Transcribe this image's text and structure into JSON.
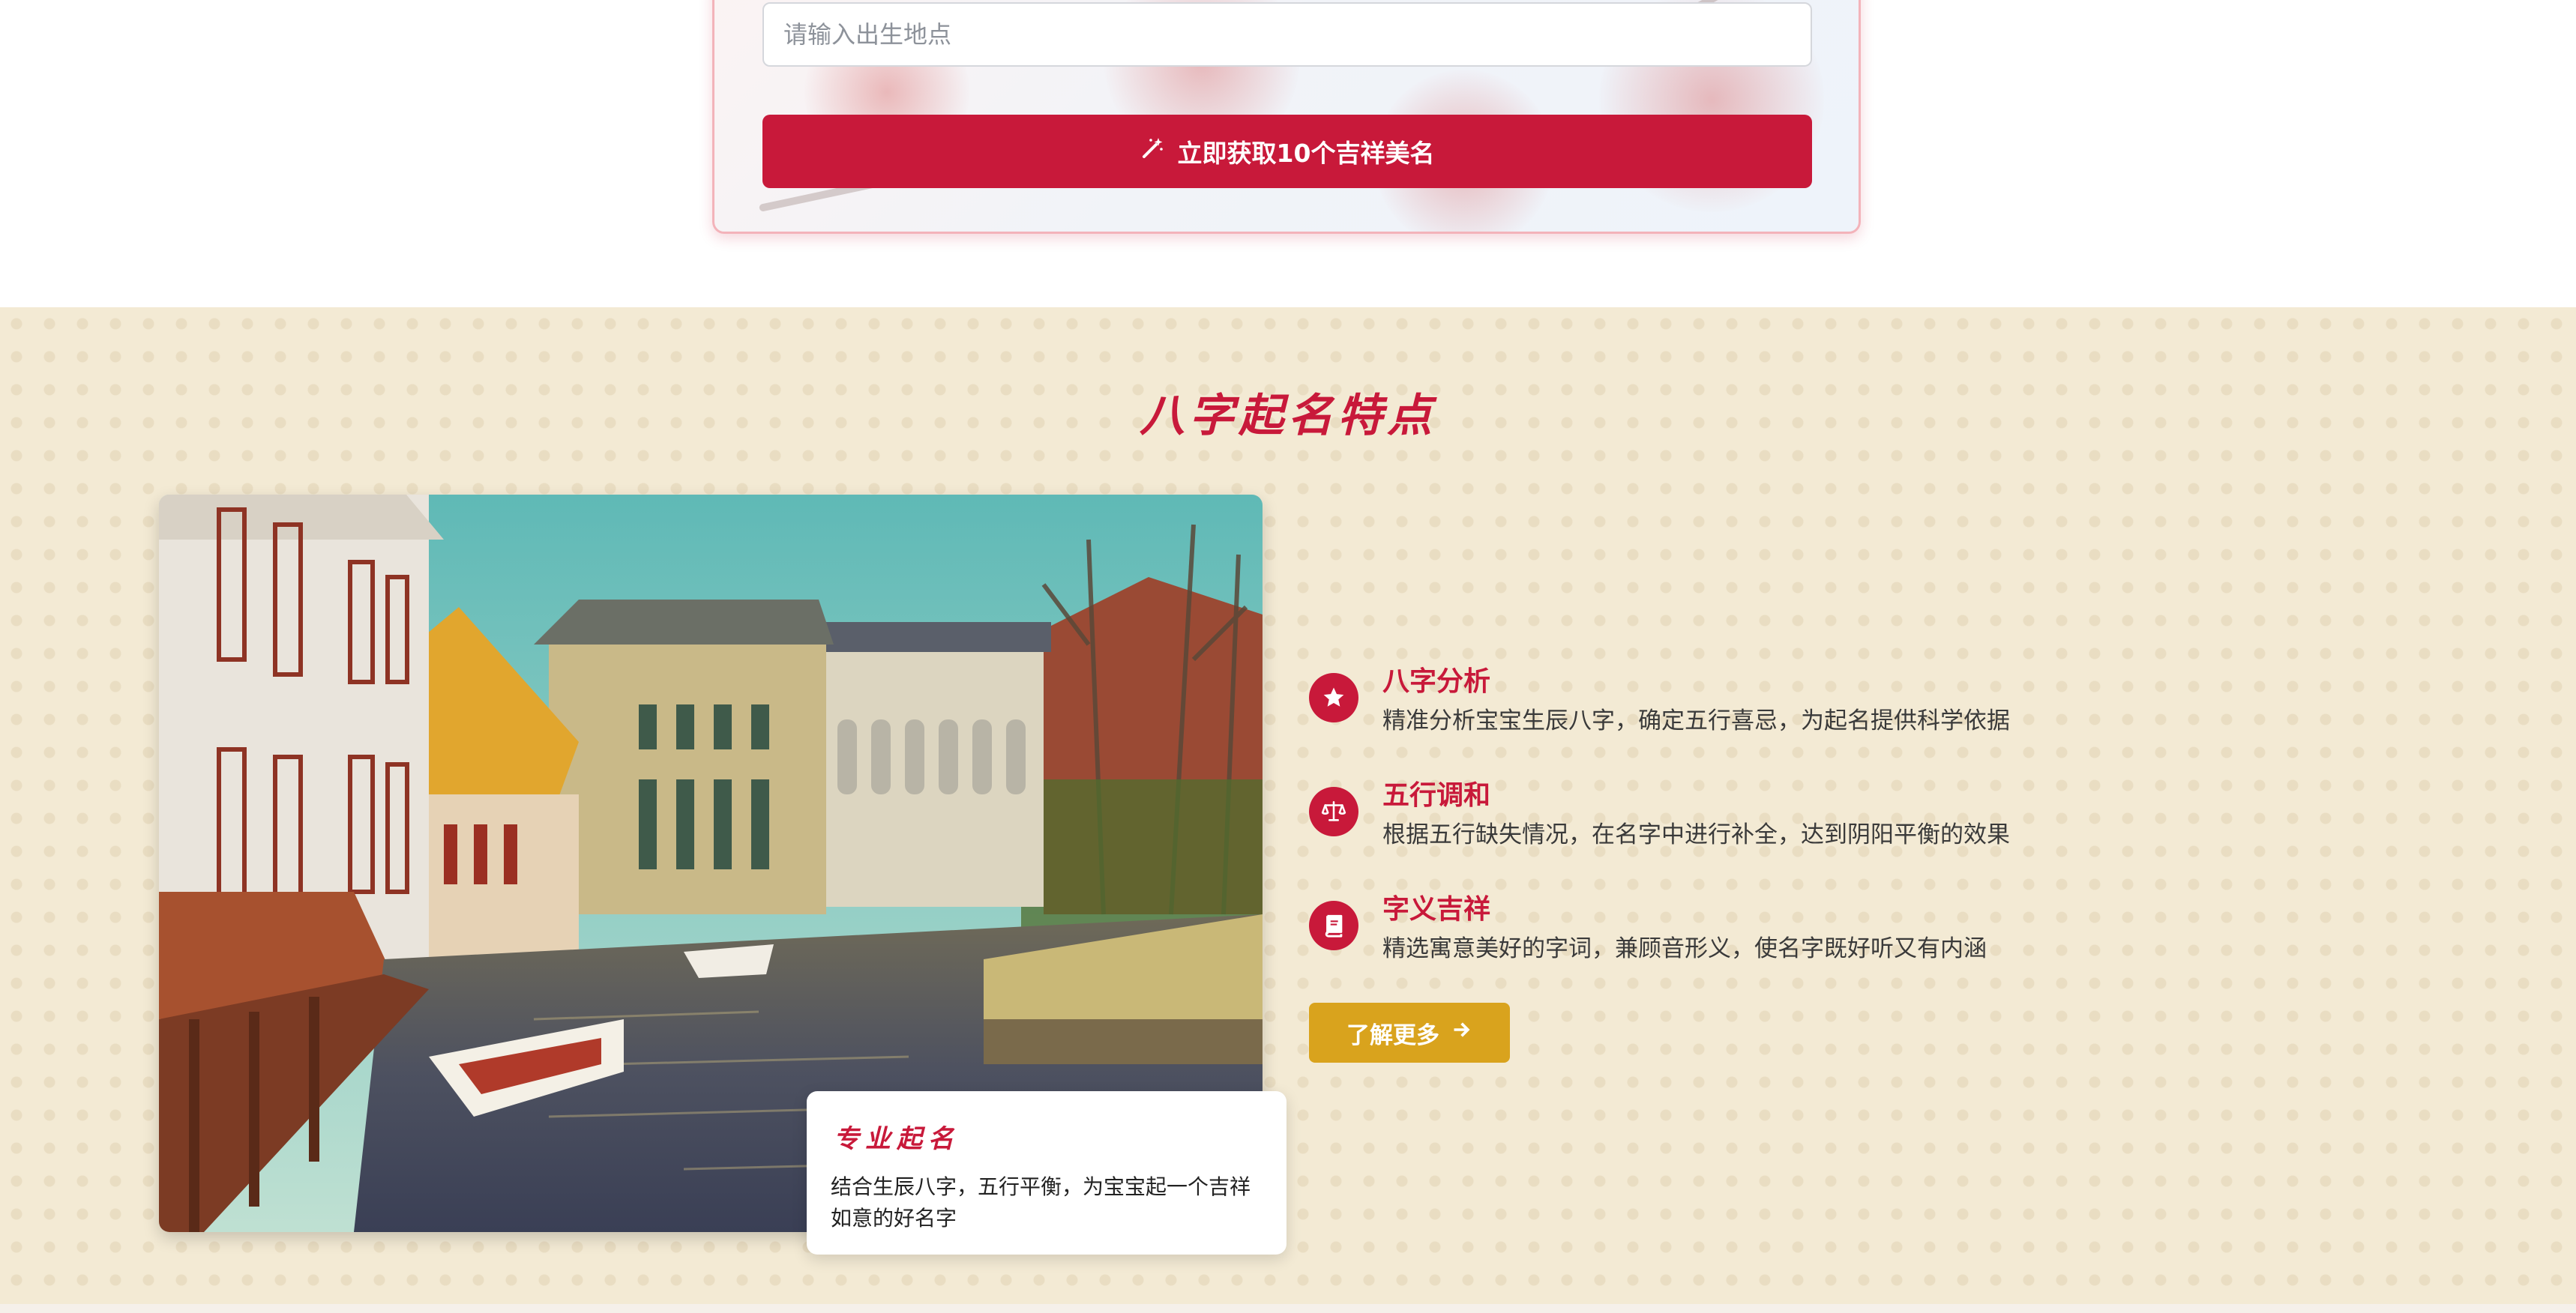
{
  "form": {
    "birthplace_placeholder": "请输入出生地点",
    "submit_label": "立即获取10个吉祥美名",
    "submit_icon": "magic-wand-icon"
  },
  "features": {
    "title": "八字起名特点",
    "overlay": {
      "title": "专业起名",
      "text": "结合生辰八字，五行平衡，为宝宝起一个吉祥如意的好名字"
    },
    "items": [
      {
        "icon": "star-icon",
        "title": "八字分析",
        "desc": "精准分析宝宝生辰八字，确定五行喜忌，为起名提供科学依据"
      },
      {
        "icon": "balance-scale-icon",
        "title": "五行调和",
        "desc": "根据五行缺失情况，在名字中进行补全，达到阴阳平衡的效果"
      },
      {
        "icon": "book-icon",
        "title": "字义吉祥",
        "desc": "精选寓意美好的字词，兼顾音形义，使名字既好听又有内涵"
      }
    ],
    "more_label": "了解更多",
    "more_icon": "arrow-right-icon"
  },
  "colors": {
    "primary_red": "#c8193a",
    "gold": "#d9a31d",
    "section_bg": "#f3ead4"
  }
}
